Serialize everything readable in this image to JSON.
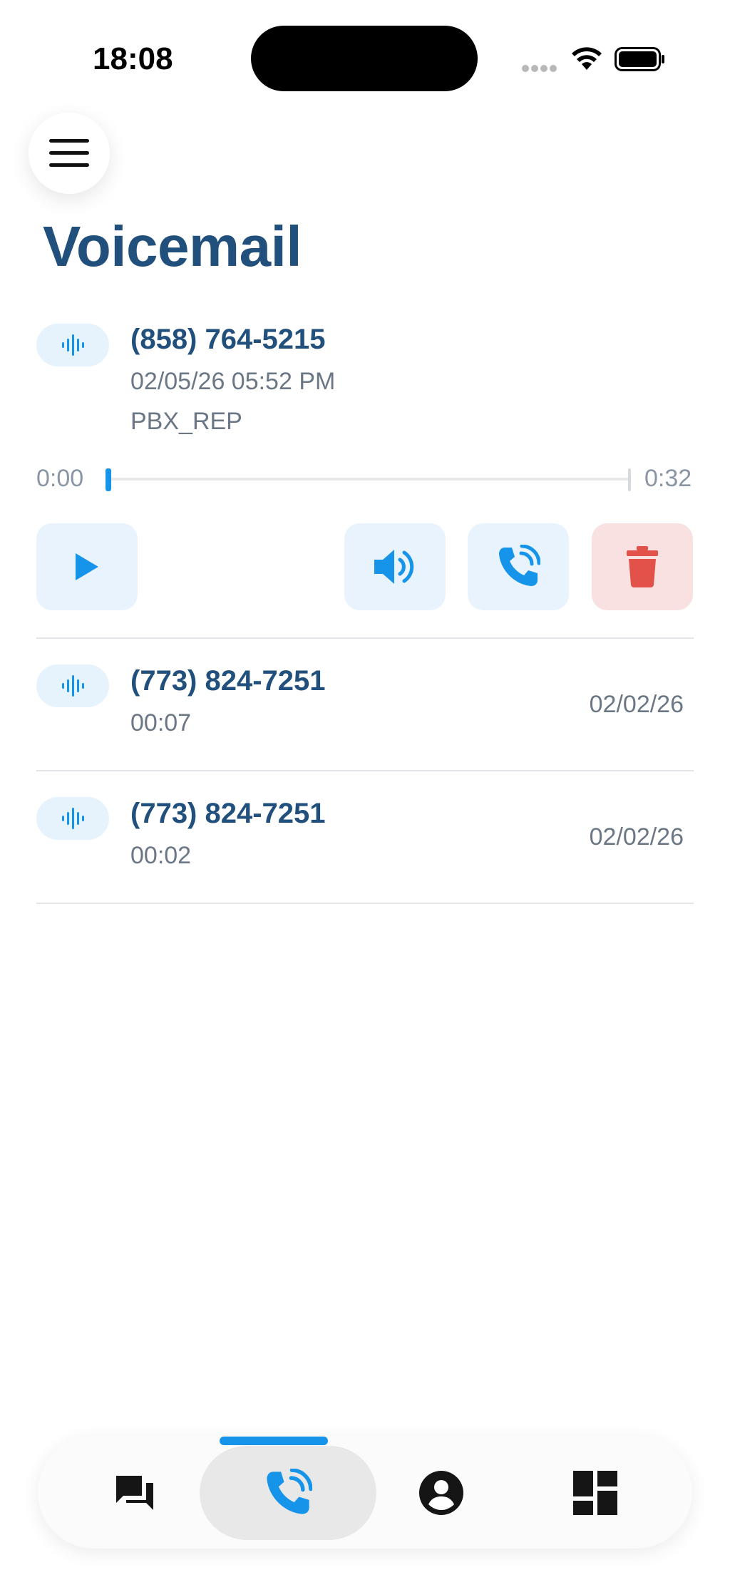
{
  "status_bar": {
    "time": "18:08"
  },
  "page": {
    "title": "Voicemail"
  },
  "expanded_voicemail": {
    "number": "(858) 764-5215",
    "datetime": "02/05/26 05:52 PM",
    "extension": "PBX_REP",
    "player": {
      "current_time": "0:00",
      "total_time": "0:32",
      "progress": 0
    }
  },
  "voicemails": [
    {
      "number": "(773) 824-7251",
      "duration": "00:07",
      "date": "02/02/26"
    },
    {
      "number": "(773) 824-7251",
      "duration": "00:02",
      "date": "02/02/26"
    }
  ],
  "colors": {
    "accent": "#1594ea",
    "title": "#22507c",
    "delete": "#e2514a"
  },
  "nav": {
    "items": [
      {
        "icon": "chat-icon",
        "active": false
      },
      {
        "icon": "phone-icon",
        "active": true
      },
      {
        "icon": "account-icon",
        "active": false
      },
      {
        "icon": "dashboard-icon",
        "active": false
      }
    ]
  }
}
